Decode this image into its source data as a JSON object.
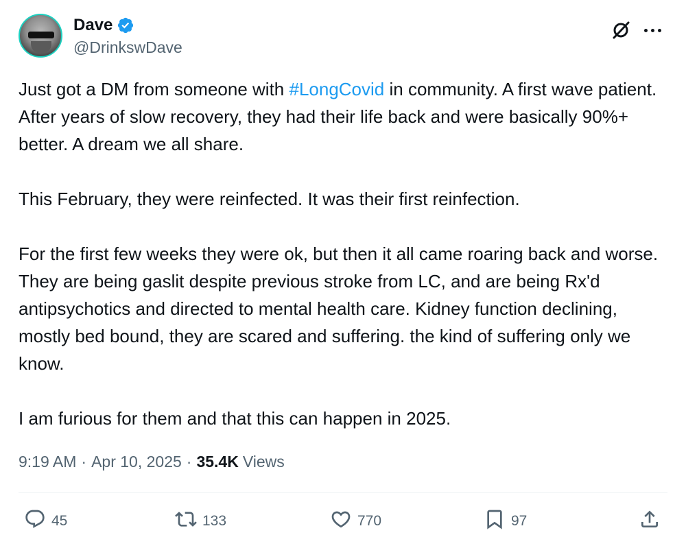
{
  "author": {
    "name": "Dave",
    "handle": "@DrinkswDave",
    "verified": true,
    "verified_color": "#1d9bf0",
    "avatar_ring_color": "#1dd1c1"
  },
  "header_icons": [
    "grok-icon",
    "more-icon"
  ],
  "tweet": {
    "p1_before": "Just got a DM from someone with ",
    "p1_hashtag": "#LongCovid",
    "p1_after": " in community. A first wave patient. After years of slow recovery, they had their life back and were basically 90%+ better. A dream we all share.",
    "p2": "This February, they were reinfected. It was their first reinfection.",
    "p3": "For the first few weeks they were ok, but then it all came roaring back and worse. They are being gaslit despite previous stroke from LC, and are being Rx'd antipsychotics and directed to mental health care. Kidney function declining, mostly bed bound, they are scared and suffering. the kind of suffering only we know.",
    "p4": "I am furious for them and that this can happen in 2025.",
    "hashtag_color": "#1d9bf0"
  },
  "meta": {
    "time": "9:19 AM",
    "date": "Apr 10, 2025",
    "separator": "·",
    "views_count": "35.4K",
    "views_label": "Views"
  },
  "actions": {
    "replies": "45",
    "reposts": "133",
    "likes": "770",
    "bookmarks": "97"
  },
  "colors": {
    "text_primary": "#0f1419",
    "text_secondary": "#536471"
  }
}
